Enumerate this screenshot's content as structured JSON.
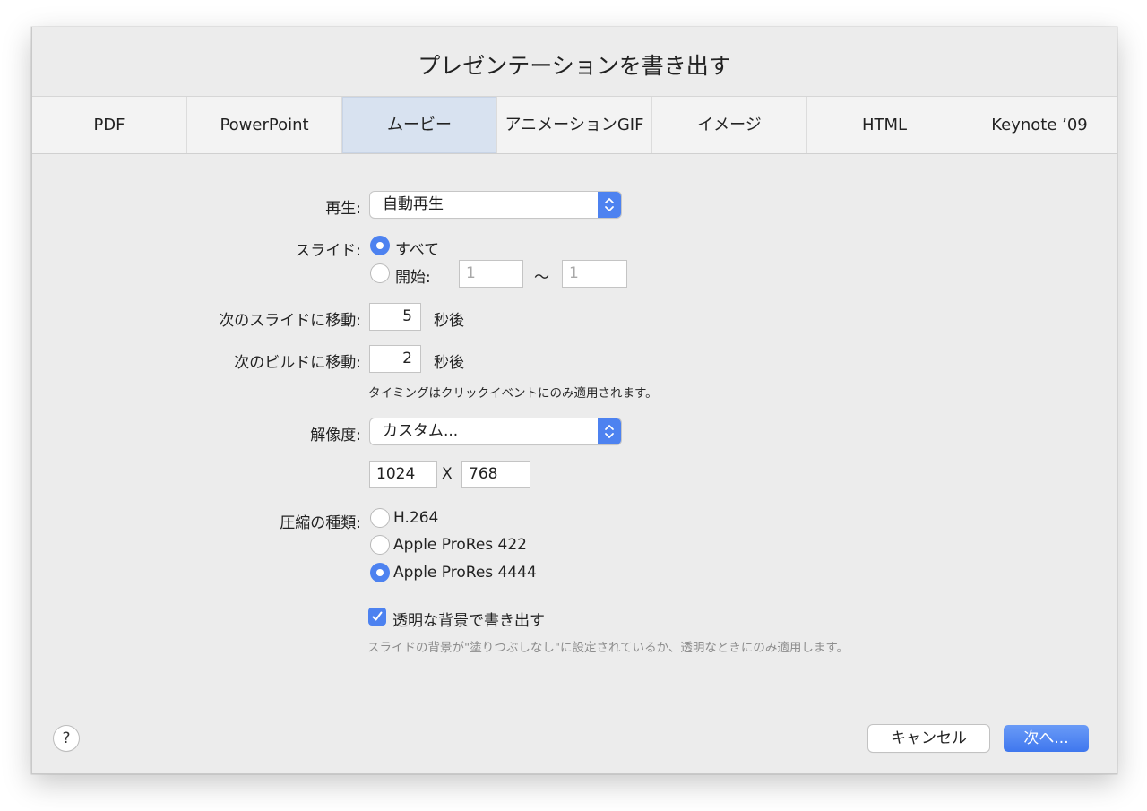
{
  "dialog": {
    "title": "プレゼンテーションを書き出す"
  },
  "tabs": [
    {
      "label": "PDF",
      "active": false
    },
    {
      "label": "PowerPoint",
      "active": false
    },
    {
      "label": "ムービー",
      "active": true
    },
    {
      "label": "アニメーションGIF",
      "active": false
    },
    {
      "label": "イメージ",
      "active": false
    },
    {
      "label": "HTML",
      "active": false
    },
    {
      "label": "Keynote ’09",
      "active": false
    }
  ],
  "playback": {
    "label": "再生:",
    "value": "自動再生"
  },
  "slides": {
    "label": "スライド:",
    "all_label": "すべて",
    "all_selected": true,
    "from_label": "開始:",
    "from_value": "1",
    "range_separator": "〜",
    "to_value": "1"
  },
  "next_slide": {
    "label": "次のスライドに移動:",
    "value": "5",
    "unit": "秒後"
  },
  "next_build": {
    "label": "次のビルドに移動:",
    "value": "2",
    "unit": "秒後"
  },
  "timing_note": "タイミングはクリックイベントにのみ適用されます。",
  "resolution": {
    "label": "解像度:",
    "value": "カスタム...",
    "width": "1024",
    "separator": "X",
    "height": "768"
  },
  "compression": {
    "label": "圧縮の種類:",
    "options": [
      {
        "label": "H.264",
        "selected": false
      },
      {
        "label": "Apple ProRes 422",
        "selected": false
      },
      {
        "label": "Apple ProRes 4444",
        "selected": true
      }
    ]
  },
  "transparent": {
    "label": "透明な背景で書き出す",
    "checked": true,
    "note": "スライドの背景が\"塗りつぶしなし\"に設定されているか、透明なときにのみ適用します。"
  },
  "footer": {
    "help_label": "?",
    "cancel_label": "キャンセル",
    "next_label": "次へ..."
  },
  "colors": {
    "accent": "#4d82f0",
    "active_tab": "#d8e2f0",
    "sheet_bg": "#ececec"
  }
}
